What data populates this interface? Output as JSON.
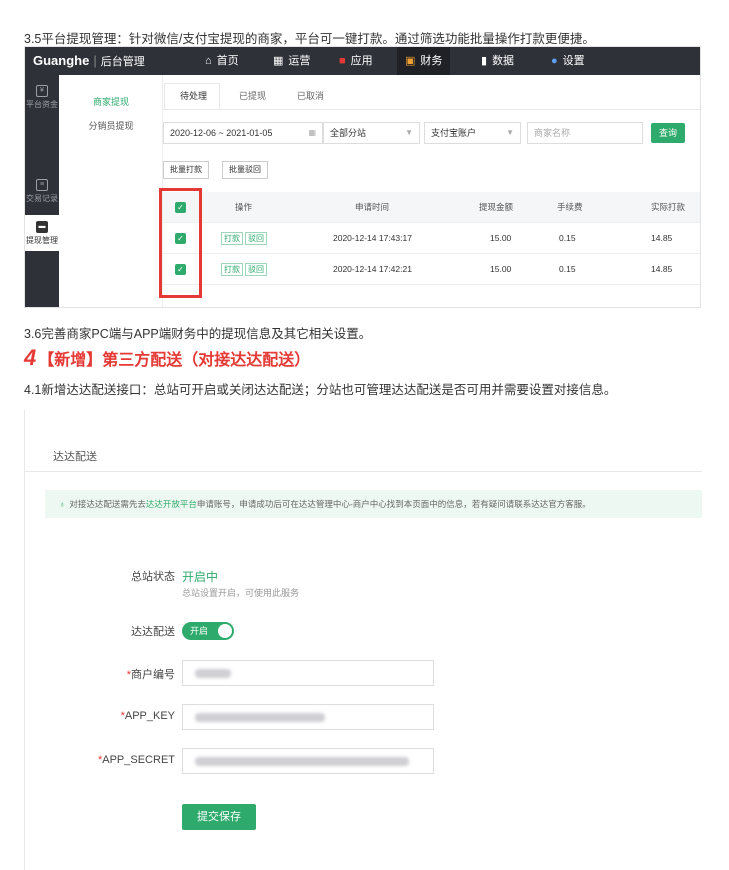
{
  "intro_3_5": "3.5平台提现管理：针对微信/支付宝提现的商家，平台可一键打款。通过筛选功能批量操作打款更便捷。",
  "shot1": {
    "logo": "Guanghe",
    "logo_sub": "后台管理",
    "topnav": [
      {
        "icon": "home-icon",
        "label": "首页"
      },
      {
        "icon": "chart-icon",
        "label": "运营"
      },
      {
        "icon": "apps-icon",
        "label": "应用"
      },
      {
        "icon": "finance-icon",
        "label": "财务",
        "active": true
      },
      {
        "icon": "data-icon",
        "label": "数据"
      },
      {
        "icon": "settings-icon",
        "label": "设置"
      }
    ],
    "leftnav": [
      {
        "icon": "yen-icon",
        "label": "平台资金"
      },
      {
        "icon": "doc-icon",
        "label": "交易记录"
      },
      {
        "icon": "wallet-icon",
        "label": "提现管理",
        "active": true
      }
    ],
    "subnav": [
      "商家提现",
      "分销员提现"
    ],
    "tabs": [
      "待处理",
      "已提现",
      "已取消"
    ],
    "filters": {
      "date_range": "2020-12-06 ~ 2021-01-05",
      "branch": "全部分站",
      "account": "支付宝账户",
      "merchant_placeholder": "商家名称",
      "query": "查询"
    },
    "bulk_buttons": [
      "批量打款",
      "批量驳回"
    ],
    "table": {
      "headers": [
        "操作",
        "申请时间",
        "提现金额",
        "手续费",
        "实际打款"
      ],
      "rows": [
        {
          "actions": [
            "打款",
            "驳回"
          ],
          "time": "2020-12-14 17:43:17",
          "amount": "15.00",
          "fee": "0.15",
          "actual": "14.85"
        },
        {
          "actions": [
            "打款",
            "驳回"
          ],
          "time": "2020-12-14 17:42:21",
          "amount": "15.00",
          "fee": "0.15",
          "actual": "14.85"
        }
      ]
    },
    "colors": {
      "accent": "#2eab6c",
      "dark": "#2f3138",
      "highlight": "#e53935"
    }
  },
  "text_3_6": "3.6完善商家PC端与APP端财务中的提现信息及其它相关设置。",
  "heading4": {
    "num": "4",
    "text": "【新增】第三方配送（对接达达配送）"
  },
  "text_4_1_lead": "4.1新增达达配送接口：",
  "text_4_1_body": "总站可开启或关闭达达配送；分站也可管理达达配送是否可用并需要设置对接信息。",
  "shot2": {
    "title": "达达配送",
    "notice_pre": "对接达达配送需先去",
    "notice_link": "达达开放平台",
    "notice_post": "申请账号，申请成功后可在达达管理中心-商户中心找到本页面中的信息，若有疑问请联系达达官方客服。",
    "status_label": "总站状态",
    "status_value": "开启中",
    "status_hint": "总站设置开启，可使用此服务",
    "toggle_label": "达达配送",
    "toggle_text": "开启",
    "merchant_label": "商户编号",
    "app_key_label": "APP_KEY",
    "app_secret_label": "APP_SECRET",
    "save": "提交保存"
  }
}
